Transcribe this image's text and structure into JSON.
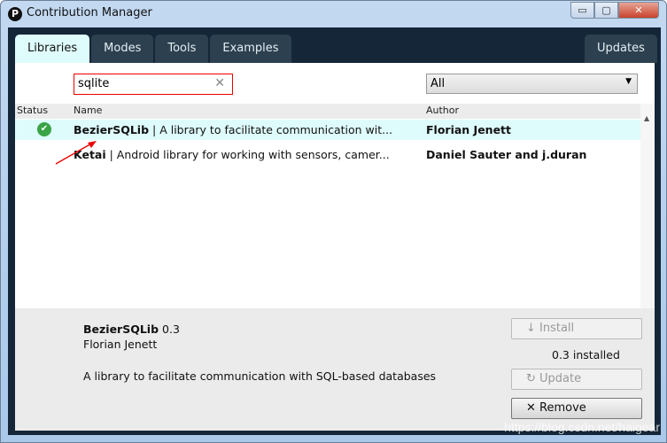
{
  "window": {
    "title": "Contribution Manager",
    "logo_text": "P",
    "minimize": "▭",
    "maximize": "▢",
    "close": "✕"
  },
  "tabs": [
    {
      "label": "Libraries",
      "active": true
    },
    {
      "label": "Modes"
    },
    {
      "label": "Tools"
    },
    {
      "label": "Examples"
    }
  ],
  "updates_tab": "Updates",
  "search": {
    "value": "sqlite",
    "clear": "✕"
  },
  "filter": {
    "selected": "All"
  },
  "columns": {
    "status": "Status",
    "name": "Name",
    "author": "Author"
  },
  "rows": [
    {
      "name": "BezierSQLib",
      "desc": " | A library to facilitate communication wit...",
      "author": "Florian Jenett",
      "installed": true,
      "selected": true
    },
    {
      "name": "Ketai",
      "desc": " | Android library for working with sensors, camer...",
      "author": "Daniel Sauter and j.duran",
      "installed": false
    }
  ],
  "detail": {
    "name": "BezierSQLib",
    "version": "0.3",
    "author": "Florian Jenett",
    "description": "A library to facilitate communication with SQL-based databases",
    "installed_text": "0.3 installed"
  },
  "buttons": {
    "install": "↓ Install",
    "update": "↻ Update",
    "remove": "✕ Remove"
  },
  "colors": {
    "selected_row": "#dffcfc",
    "tab_bar": "#142637",
    "annotation": "#e00000"
  },
  "watermark": "https://blog.csdn.net/haigear"
}
